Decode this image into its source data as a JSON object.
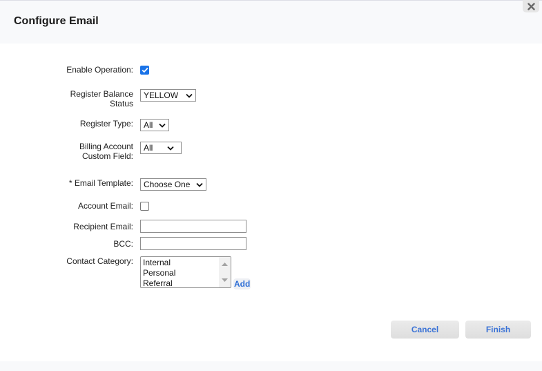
{
  "dialog": {
    "title": "Configure Email",
    "close_icon": "close-x-icon"
  },
  "form": {
    "enable_operation": {
      "label": "Enable Operation:",
      "checked": true
    },
    "register_balance_status": {
      "label_line1": "Register Balance",
      "label_line2": "Status",
      "value": "YELLOW"
    },
    "register_type": {
      "label": "Register Type:",
      "value": "All"
    },
    "billing_account_custom_field": {
      "label_line1": "Billing Account",
      "label_line2": "Custom Field:",
      "value": "All"
    },
    "email_template": {
      "label": "* Email Template:",
      "value": "Choose One"
    },
    "account_email": {
      "label": "Account Email:",
      "checked": false
    },
    "recipient_email": {
      "label": "Recipient Email:",
      "value": "",
      "placeholder": ""
    },
    "bcc": {
      "label": "BCC:",
      "value": "",
      "placeholder": ""
    },
    "contact_category": {
      "label": "Contact Category:",
      "options": [
        "Internal",
        "Personal",
        "Referral"
      ],
      "add_label": "Add"
    }
  },
  "buttons": {
    "cancel": "Cancel",
    "finish": "Finish"
  },
  "colors": {
    "accent": "#1a73e8",
    "link": "#2f6fd6"
  }
}
